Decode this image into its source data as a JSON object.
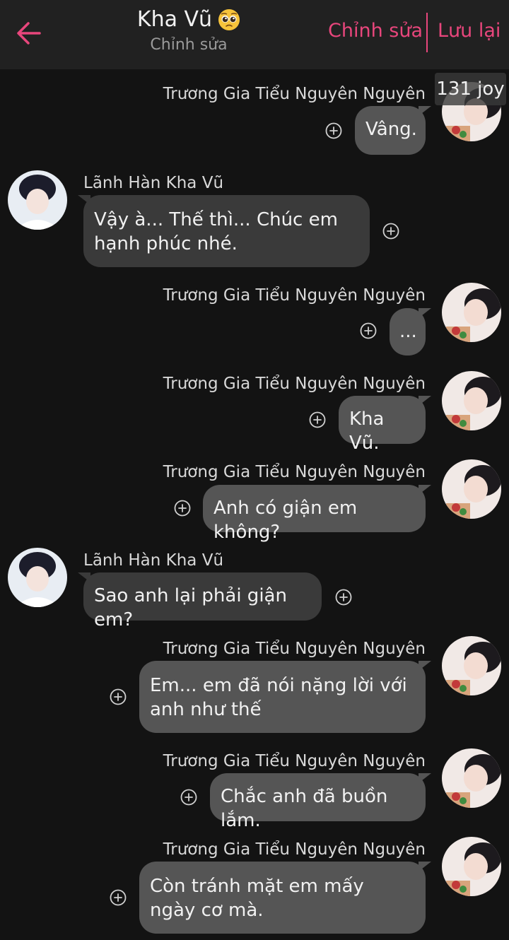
{
  "header": {
    "title": "Kha Vũ",
    "title_emoji": "pleading-face-emoji",
    "subtitle": "Chỉnh sửa",
    "edit_label": "Chỉnh sửa",
    "save_label": "Lưu lại",
    "back_icon": "arrow-left-icon",
    "accent_color": "#e8467c"
  },
  "counter": {
    "text": "131 joy"
  },
  "participants": {
    "me": "Trương Gia Tiểu Nguyên Nguyên",
    "other": "Lãnh Hàn Kha Vũ"
  },
  "messages": [
    {
      "side": "right",
      "sender": "Trương Gia Tiểu Nguyên Nguyên",
      "text": "Vâng."
    },
    {
      "side": "left",
      "sender": "Lãnh Hàn Kha Vũ",
      "text": "Vậy à... Thế thì... Chúc em hạnh phúc nhé."
    },
    {
      "side": "right",
      "sender": "Trương Gia Tiểu Nguyên Nguyên",
      "text": "..."
    },
    {
      "side": "right",
      "sender": "Trương Gia Tiểu Nguyên Nguyên",
      "text": "Kha Vũ."
    },
    {
      "side": "right",
      "sender": "Trương Gia Tiểu Nguyên Nguyên",
      "text": "Anh có giận em không?"
    },
    {
      "side": "left",
      "sender": "Lãnh Hàn Kha Vũ",
      "text": "Sao anh lại phải giận em?"
    },
    {
      "side": "right",
      "sender": "Trương Gia Tiểu Nguyên Nguyên",
      "text": "Em... em đã nói nặng lời với anh như thế"
    },
    {
      "side": "right",
      "sender": "Trương Gia Tiểu Nguyên Nguyên",
      "text": "Chắc anh đã buồn lắm."
    },
    {
      "side": "right",
      "sender": "Trương Gia Tiểu Nguyên Nguyên",
      "text": "Còn tránh mặt em mấy ngày cơ mà."
    }
  ]
}
